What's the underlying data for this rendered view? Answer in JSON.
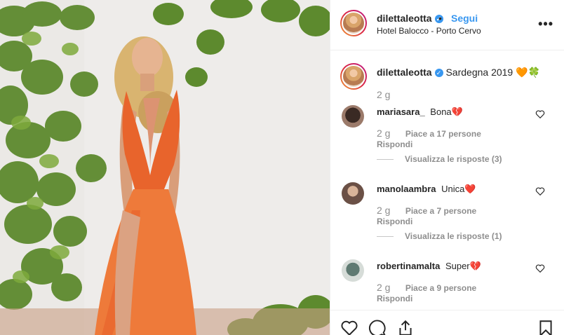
{
  "post": {
    "username": "dilettaleotta",
    "follow_label": "Segui",
    "separator": "•",
    "location": "Hotel Balocco - Porto Cervo",
    "more_label": "•••"
  },
  "caption": {
    "username": "dilettaleotta",
    "text": "Sardegna 2019",
    "emojis": "🧡🍀",
    "time": "2 g"
  },
  "comments": [
    {
      "username": "mariasara_",
      "text": "Bona",
      "emoji": "💔",
      "time": "2 g",
      "likes": "Piace a 17 persone",
      "reply": "Rispondi",
      "view_replies": "Visualizza le risposte (3)"
    },
    {
      "username": "manolaambra",
      "text": "Unica",
      "emoji": "❤️",
      "time": "2 g",
      "likes": "Piace a 7 persone",
      "reply": "Rispondi",
      "view_replies": "Visualizza le risposte (1)"
    },
    {
      "username": "robertinamalta",
      "text": "Super",
      "emoji": "💔",
      "time": "2 g",
      "likes": "Piace a 9 persone",
      "reply": "Rispondi"
    }
  ],
  "icons": {
    "like": "heart-icon",
    "comment": "comment-icon",
    "share": "share-icon",
    "save": "bookmark-icon",
    "verified": "verified-badge-icon",
    "more": "more-options-icon"
  },
  "colors": {
    "link_blue": "#3897f0",
    "muted": "#8e8e8e",
    "dress_orange": "#e8642c",
    "heart_red": "#ed4956"
  }
}
